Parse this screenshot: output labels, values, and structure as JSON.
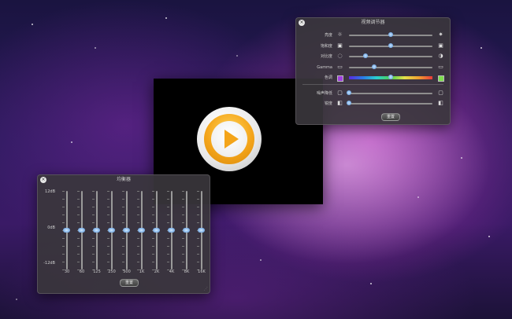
{
  "video_adjust": {
    "title": "视频调节器",
    "rows": [
      {
        "label": "亮度",
        "left_icon": "brightness-low-icon",
        "right_icon": "brightness-high-icon",
        "value": 0.5
      },
      {
        "label": "饱和度",
        "left_icon": "saturation-low-icon",
        "right_icon": "saturation-high-icon",
        "value": 0.5
      },
      {
        "label": "对比度",
        "left_icon": "contrast-low-icon",
        "right_icon": "contrast-high-icon",
        "value": 0.2
      },
      {
        "label": "Gamma",
        "left_icon": "gamma-low-icon",
        "right_icon": "gamma-high-icon",
        "value": 0.3
      },
      {
        "label": "色调",
        "left_icon": "hue-purple-swatch",
        "right_icon": "hue-green-swatch",
        "value": 0.5
      },
      {
        "label": "噪声降低",
        "left_icon": "noise-low-icon",
        "right_icon": "noise-high-icon",
        "value": 0.0
      },
      {
        "label": "锐度",
        "left_icon": "sharpness-low-icon",
        "right_icon": "sharpness-high-icon",
        "value": 0.0
      }
    ],
    "reset_label": "重置"
  },
  "equalizer": {
    "title": "均衡器",
    "db_top": "12dB",
    "db_mid": "0dB",
    "db_bottom": "-12dB",
    "bands": [
      {
        "freq": "30",
        "value": 0
      },
      {
        "freq": "60",
        "value": 0
      },
      {
        "freq": "125",
        "value": 0
      },
      {
        "freq": "250",
        "value": 0
      },
      {
        "freq": "500",
        "value": 0
      },
      {
        "freq": "1K",
        "value": 0
      },
      {
        "freq": "2K",
        "value": 0
      },
      {
        "freq": "4K",
        "value": 0
      },
      {
        "freq": "8K",
        "value": 0
      },
      {
        "freq": "16K",
        "value": 0
      }
    ],
    "reset_label": "重置"
  },
  "colors": {
    "panel_bg": "#3a363c",
    "knob_blue": "#4f8fd8",
    "play_orange": "#f4a51a"
  }
}
